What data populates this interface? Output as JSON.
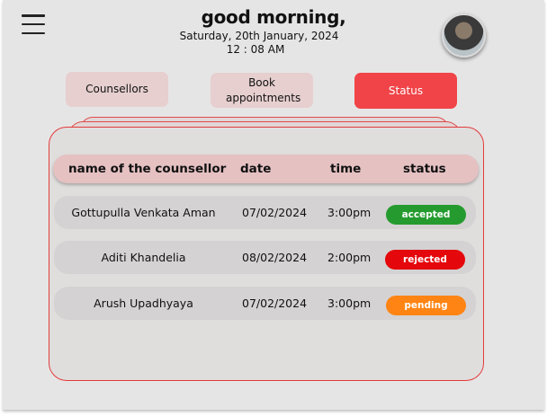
{
  "header": {
    "greeting": "good morning,",
    "date": "Saturday, 20th January, 2024",
    "time": "12 : 08 AM"
  },
  "icons": {
    "menu": "hamburger-menu-icon",
    "avatar": "profile-avatar"
  },
  "nav": {
    "counsellors": "Counsellors",
    "book": "Book appointments",
    "status": "Status",
    "active": "status"
  },
  "colors": {
    "active_nav": "#f04448",
    "nav_inactive": "#e7cfcf",
    "card_border": "#e33b3b",
    "accepted": "#259b2f",
    "rejected": "#e4070b",
    "pending": "#ff8414"
  },
  "table": {
    "headers": {
      "name": "name of the counsellor",
      "date": "date",
      "time": "time",
      "status": "status"
    },
    "rows": [
      {
        "name": "Gottupulla Venkata Aman",
        "date": "07/02/2024",
        "time": "3:00pm",
        "status": "accepted"
      },
      {
        "name": "Aditi Khandelia",
        "date": "08/02/2024",
        "time": "2:00pm",
        "status": "rejected"
      },
      {
        "name": "Arush Upadhyaya",
        "date": "07/02/2024",
        "time": "3:00pm",
        "status": "pending"
      }
    ]
  }
}
